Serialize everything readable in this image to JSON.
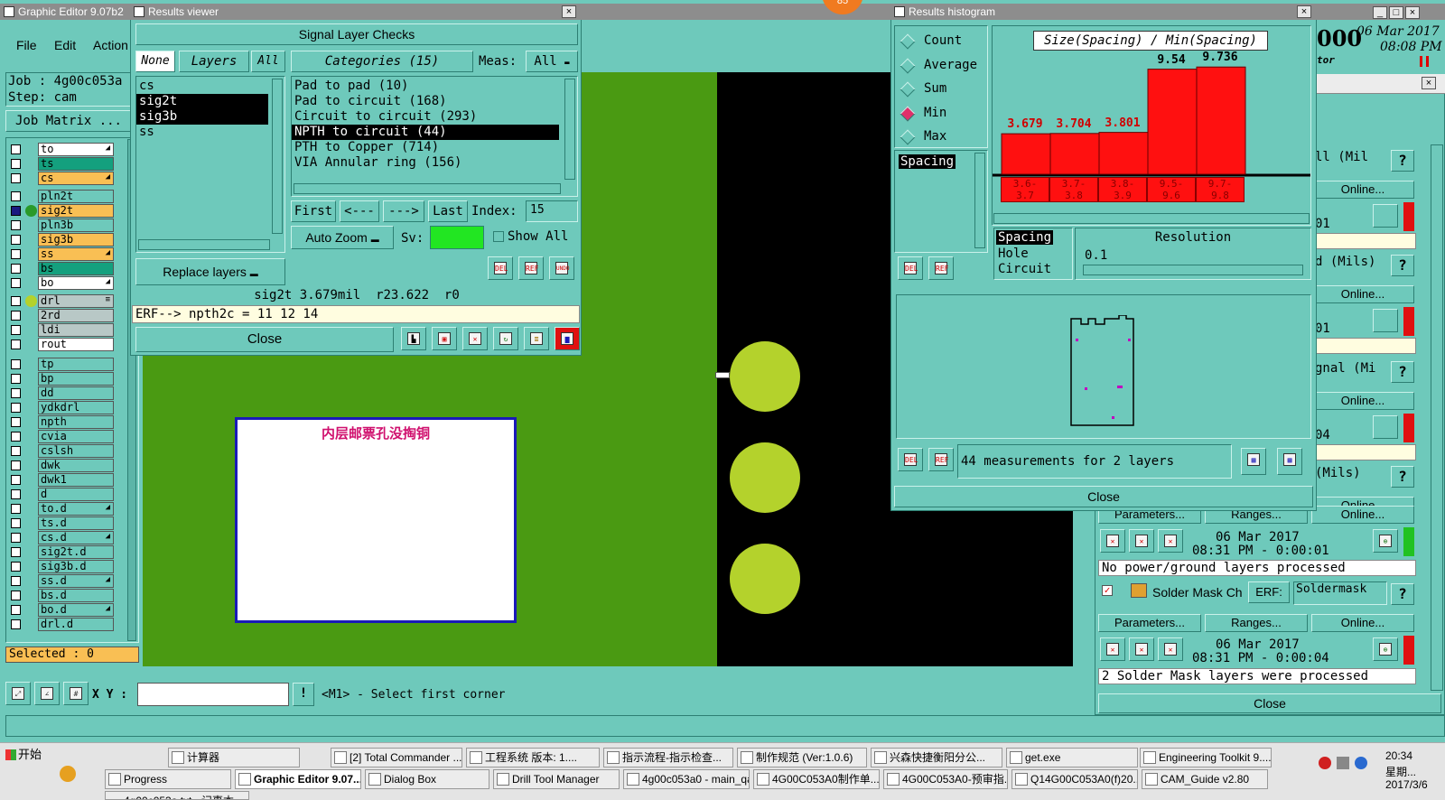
{
  "main_window": {
    "title": "Graphic Editor 9.07b2",
    "menu": [
      "File",
      "Edit",
      "Action"
    ],
    "job_label": "Job : 4g00c053a",
    "step_label": "Step: cam",
    "job_matrix_button": "Job Matrix ...",
    "selected_label": "Selected : 0",
    "xy_label": "X Y :",
    "xy_value": "",
    "status_hint": "<M1> - Select first corner",
    "date_top": "06 Mar 2017",
    "time_top": "08:08 PM",
    "big_number": "000",
    "small_label": "tor",
    "badge_number": "85",
    "board_annotation": "内层邮票孔没掏铜"
  },
  "layers": [
    {
      "name": "to",
      "color": "white",
      "mark": "◢"
    },
    {
      "name": "ts",
      "color": "green",
      "mark": ""
    },
    {
      "name": "cs",
      "color": "orange",
      "mark": "◢"
    },
    {
      "name": "pln2t",
      "color": "teal",
      "mark": ""
    },
    {
      "name": "sig2t",
      "color": "orange",
      "mark": ""
    },
    {
      "name": "pln3b",
      "color": "teal",
      "mark": ""
    },
    {
      "name": "sig3b",
      "color": "orange",
      "mark": ""
    },
    {
      "name": "ss",
      "color": "orange",
      "mark": "◢"
    },
    {
      "name": "bs",
      "color": "green",
      "mark": ""
    },
    {
      "name": "bo",
      "color": "white",
      "mark": "◢"
    },
    {
      "name": "drl",
      "color": "gray",
      "mark": "≡"
    },
    {
      "name": "2rd",
      "color": "gray",
      "mark": ""
    },
    {
      "name": "ldi",
      "color": "gray",
      "mark": ""
    },
    {
      "name": "rout",
      "color": "white",
      "mark": ""
    },
    {
      "name": "tp",
      "color": "teal",
      "mark": ""
    },
    {
      "name": "bp",
      "color": "teal",
      "mark": ""
    },
    {
      "name": "dd",
      "color": "teal",
      "mark": ""
    },
    {
      "name": "ydkdrl",
      "color": "teal",
      "mark": ""
    },
    {
      "name": "npth",
      "color": "teal",
      "mark": ""
    },
    {
      "name": "cvia",
      "color": "teal",
      "mark": ""
    },
    {
      "name": "cslsh",
      "color": "teal",
      "mark": ""
    },
    {
      "name": "dwk",
      "color": "teal",
      "mark": ""
    },
    {
      "name": "dwk1",
      "color": "teal",
      "mark": ""
    },
    {
      "name": "d",
      "color": "teal",
      "mark": ""
    },
    {
      "name": "to.d",
      "color": "teal",
      "mark": "◢"
    },
    {
      "name": "ts.d",
      "color": "teal",
      "mark": ""
    },
    {
      "name": "cs.d",
      "color": "teal",
      "mark": "◢"
    },
    {
      "name": "sig2t.d",
      "color": "teal",
      "mark": ""
    },
    {
      "name": "sig3b.d",
      "color": "teal",
      "mark": ""
    },
    {
      "name": "ss.d",
      "color": "teal",
      "mark": "◢"
    },
    {
      "name": "bs.d",
      "color": "teal",
      "mark": ""
    },
    {
      "name": "bo.d",
      "color": "teal",
      "mark": "◢"
    },
    {
      "name": "drl.d",
      "color": "teal",
      "mark": ""
    }
  ],
  "results_viewer": {
    "title": "Results viewer",
    "header": "Signal Layer Checks",
    "none_btn": "None",
    "layers_btn": "Layers",
    "all_btn": "All",
    "layer_list": [
      {
        "name": "cs",
        "selected": false
      },
      {
        "name": "sig2t",
        "selected": true
      },
      {
        "name": "sig3b",
        "selected": true
      },
      {
        "name": "ss",
        "selected": false
      }
    ],
    "categories_btn": "Categories (15)",
    "meas_label": "Meas:",
    "meas_value": "All",
    "categories": [
      {
        "name": "Pad to pad (10)",
        "selected": false
      },
      {
        "name": "Pad to circuit (168)",
        "selected": false
      },
      {
        "name": "Circuit to circuit (293)",
        "selected": false
      },
      {
        "name": "NPTH to circuit (44)",
        "selected": true
      },
      {
        "name": "PTH to Copper (714)",
        "selected": false
      },
      {
        "name": "VIA Annular ring (156)",
        "selected": false
      }
    ],
    "first_btn": "First",
    "prev_btn": "<---",
    "next_btn": "--->",
    "last_btn": "Last",
    "index_label": "Index:",
    "index_value": "15",
    "auto_zoom": "Auto Zoom",
    "sv_label": "Sv:",
    "show_all": "Show All",
    "replace_layers": "Replace layers",
    "measure_line": "sig2t 3.679mil  r23.622  r0",
    "erf_line": "ERF--> npth2c = 11 12 14",
    "close_btn": "Close",
    "del_btn": "DEL",
    "ref_btn": "REF",
    "undo_btn": "UNDO"
  },
  "histogram": {
    "title": "Results histogram",
    "options": [
      {
        "label": "Count",
        "on": false
      },
      {
        "label": "Average",
        "on": false
      },
      {
        "label": "Sum",
        "on": false
      },
      {
        "label": "Min",
        "on": true
      },
      {
        "label": "Max",
        "on": false
      }
    ],
    "measure_list": [
      "Spacing"
    ],
    "chart_title": "Size(Spacing) / Min(Spacing)",
    "types": [
      "Spacing",
      "Hole",
      "Circuit"
    ],
    "resolution_label": "Resolution",
    "resolution_value": "0.1",
    "summary": "44 measurements for 2 layers",
    "close_btn": "Close",
    "del_btn": "DEL",
    "ref_btn": "REF"
  },
  "chart_data": {
    "type": "bar",
    "title": "Size(Spacing) / Min(Spacing)",
    "categories": [
      "3.6-3.7",
      "3.7-3.8",
      "3.8-3.9",
      "9.5-9.6",
      "9.7-9.8"
    ],
    "values": [
      3.679,
      3.704,
      3.801,
      9.54,
      9.736
    ],
    "value_labels": [
      "3.679",
      "3.704",
      "3.801",
      "9.54",
      "9.736"
    ],
    "category_labels": [
      {
        "top": "3.6-",
        "bottom": "3.7"
      },
      {
        "top": "3.7-",
        "bottom": "3.8"
      },
      {
        "top": "3.8-",
        "bottom": "3.9"
      },
      {
        "top": "9.5-",
        "bottom": "9.6"
      },
      {
        "top": "9.7-",
        "bottom": "9.8"
      }
    ],
    "ylim": [
      0,
      10
    ],
    "bar_color": "#ff1010"
  },
  "checklist": {
    "rows": [
      {
        "label": "ll (Mil",
        "online": "Online...",
        "time": "01",
        "status_color": "#e01010"
      },
      {
        "label": "d (Mils)",
        "online": "Online...",
        "time": "01",
        "status_color": "#e01010"
      },
      {
        "label": "gnal (Mi",
        "online": "Online...",
        "time": "04",
        "status_color": "#e01010"
      },
      {
        "label": "(Mils)",
        "online": "Online...",
        "time": "",
        "status_color": "#e01010"
      }
    ],
    "parameters_btn": "Parameters...",
    "ranges_btn": "Ranges...",
    "online_btn": "Online...",
    "power_date": "06 Mar 2017",
    "power_time": "08:31 PM - 0:00:01",
    "power_msg": "No power/ground layers processed",
    "solder_label": "Solder Mask Ch",
    "erf_label": "ERF:",
    "erf_value": "Soldermask",
    "solder_date": "06 Mar 2017",
    "solder_time": "08:31 PM - 0:00:04",
    "solder_msg": "2 Solder Mask layers were processed",
    "close_btn": "Close",
    "help": "?",
    "checkmark": "✓"
  },
  "taskbar": {
    "start": "开始",
    "row1": [
      "Progress",
      "计算器",
      "[2] Total Commander ...",
      "工程系统  版本: 1....",
      "指示流程-指示检查...",
      "制作规范 (Ver:1.0.6)",
      "兴森快捷衡阳分公...",
      "get.exe",
      "Engineering Toolkit 9...."
    ],
    "row2": [
      "Progress",
      "Graphic Editor 9.07...",
      "Dialog Box",
      "Drill Tool Manager",
      "4g00c053a0 - main_qa",
      "4G00C053A0制作单....",
      "4G00C053A0-预审指...",
      "Q14G00C053A0(f)20...",
      "CAM_Guide v2.80"
    ],
    "row3": [
      "4g00c053a.txt - 记事本"
    ],
    "clock": "20:34",
    "weekday": "星期...",
    "date": "2017/3/6"
  }
}
